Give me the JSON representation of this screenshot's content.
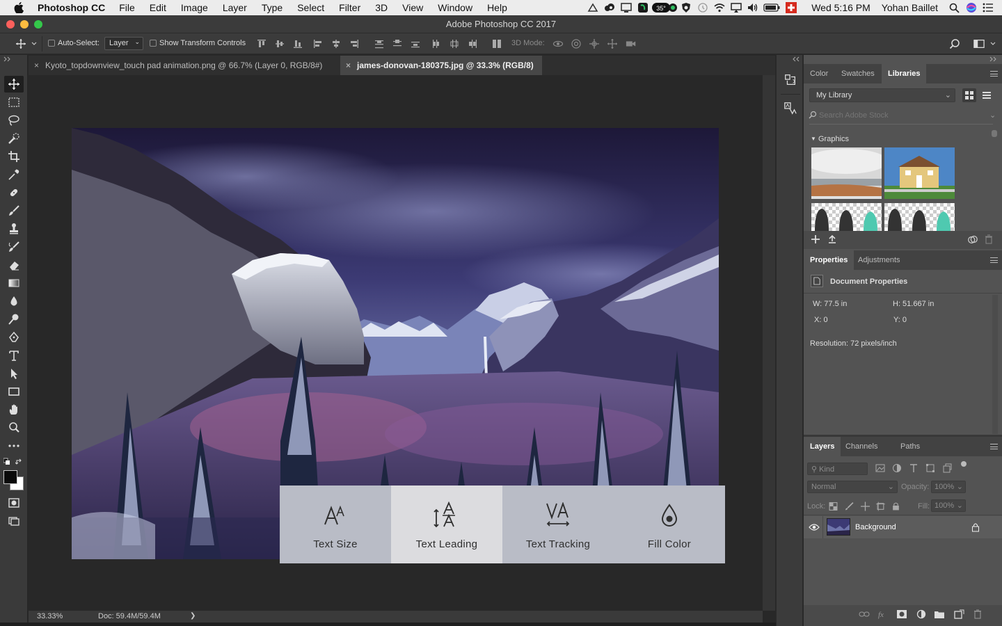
{
  "menubar": {
    "app_name": "Photoshop CC",
    "items": [
      "File",
      "Edit",
      "Image",
      "Layer",
      "Type",
      "Select",
      "Filter",
      "3D",
      "View",
      "Window",
      "Help"
    ],
    "status_icons": [
      "drive-icon",
      "creative-cloud-icon",
      "display-icon",
      "evernote-icon",
      "temperature-badge",
      "shield-icon",
      "time-machine-icon",
      "wifi-icon",
      "airplay-icon",
      "volume-icon",
      "battery-icon",
      "flag-icon"
    ],
    "temperature": "35°",
    "clock": "Wed 5:16 PM",
    "user": "Yohan Baillet"
  },
  "window": {
    "title": "Adobe Photoshop CC 2017"
  },
  "options_bar": {
    "auto_select_label": "Auto-Select:",
    "auto_select_value": "Layer",
    "show_transform_label": "Show Transform Controls",
    "mode_3d_label": "3D Mode:"
  },
  "tabs": [
    {
      "label": "Kyoto_topdownview_touch pad animation.png @ 66.7% (Layer 0, RGB/8#)",
      "close": "×"
    },
    {
      "label": "james-donovan-180375.jpg @ 33.3% (RGB/8)",
      "close": "×"
    }
  ],
  "touch_toolbar": [
    {
      "label": "Text Size",
      "icon": "text-size-icon"
    },
    {
      "label": "Text Leading",
      "icon": "text-leading-icon"
    },
    {
      "label": "Text Tracking",
      "icon": "text-tracking-icon"
    },
    {
      "label": "Fill Color",
      "icon": "fill-color-icon"
    }
  ],
  "status": {
    "zoom": "33.33%",
    "doc": "Doc: 59.4M/59.4M",
    "arrow": "❯"
  },
  "libraries": {
    "tabs": [
      "Color",
      "Swatches",
      "Libraries"
    ],
    "library_name": "My Library",
    "search_placeholder": "Search Adobe Stock",
    "section": "Graphics"
  },
  "properties": {
    "tabs": [
      "Properties",
      "Adjustments"
    ],
    "title": "Document Properties",
    "w": "W:  77.5 in",
    "h": "H:  51.667 in",
    "x": "X:  0",
    "y": "Y:  0",
    "resolution": "Resolution: 72 pixels/inch"
  },
  "layers": {
    "tabs": [
      "Layers",
      "Channels",
      "Paths"
    ],
    "kind": "Kind",
    "blend": "Normal",
    "opacity_label": "Opacity:",
    "opacity_value": "100%",
    "lock_label": "Lock:",
    "fill_label": "Fill:",
    "fill_value": "100%",
    "layer_name": "Background"
  },
  "colors": {
    "panel": "#535353",
    "tool_bg": "#3a3a3a",
    "touchbar": "#b9bcc6",
    "touchbar_active": "#dcdcdf"
  }
}
